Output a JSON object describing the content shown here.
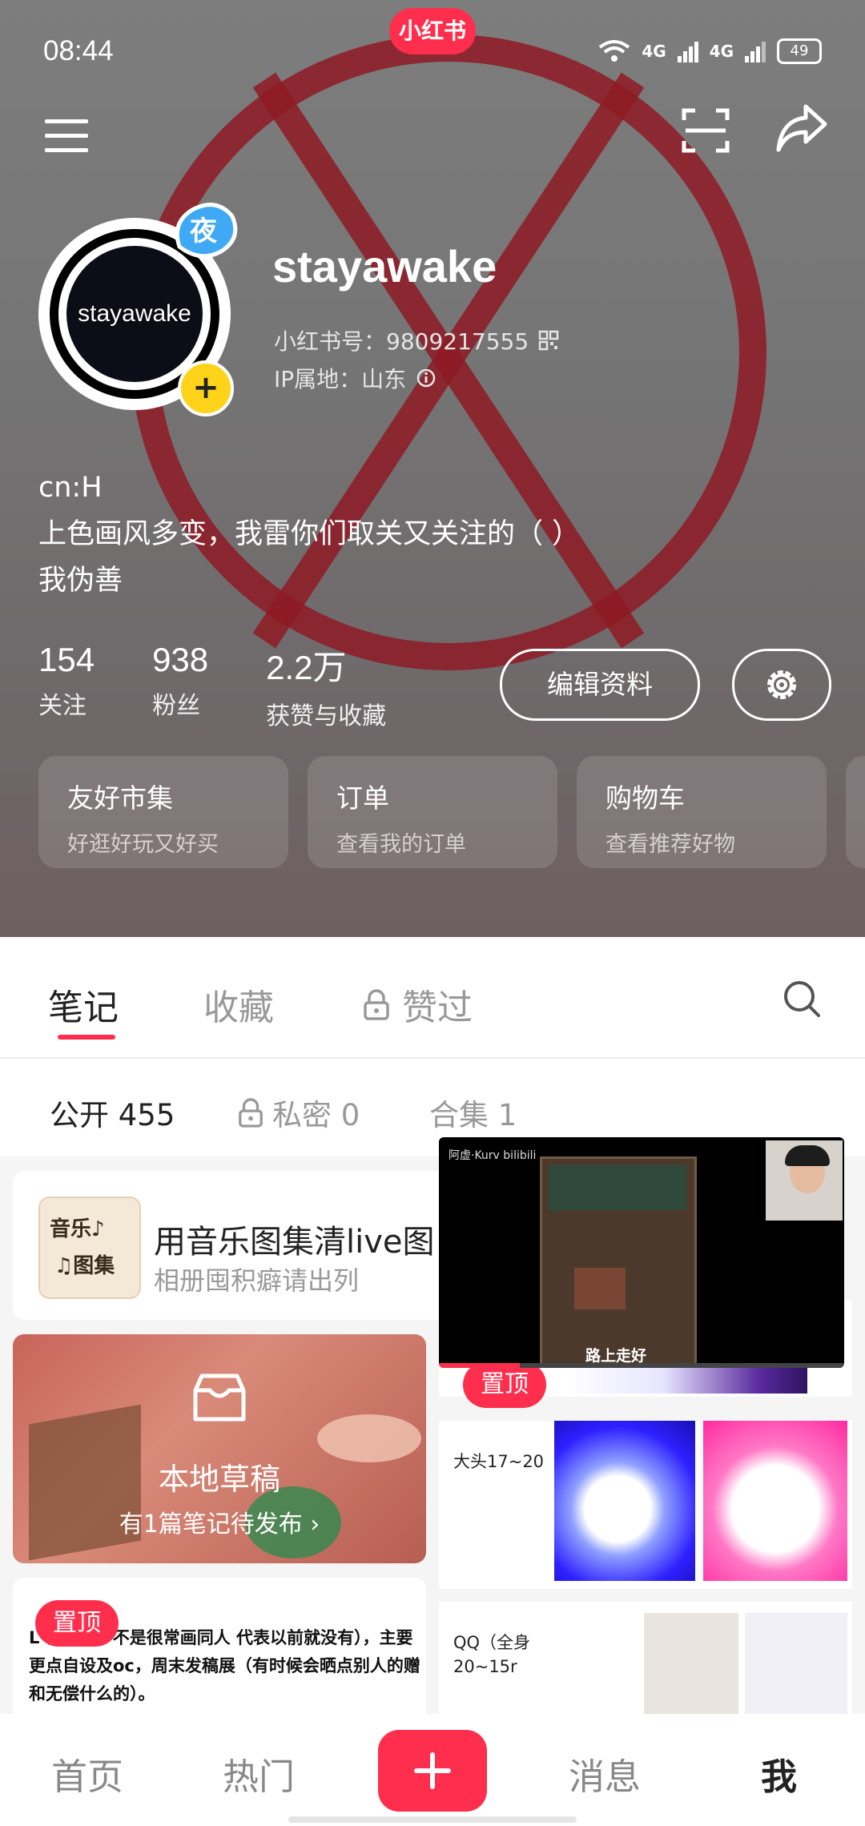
{
  "status_bar": {
    "time": "08:44",
    "app_badge": "小红书",
    "network1": "4G",
    "network2": "4G",
    "battery": "49"
  },
  "profile": {
    "avatar_text": "stayawake",
    "nickname": "stayawake",
    "redbook_id_label": "小红书号：9809217555",
    "ip_label": "IP属地：山东",
    "bio": [
      "cn:H",
      " 上色画风多变，我雷你们取关又关注的（ ）",
      "我伪善"
    ]
  },
  "stats": [
    {
      "value": "154",
      "label": "关注"
    },
    {
      "value": "938",
      "label": "粉丝"
    },
    {
      "value": "2.2万",
      "label": "获赞与收藏"
    }
  ],
  "edit_button": "编辑资料",
  "cards": [
    {
      "title": "友好市集",
      "subtitle": "好逛好玩又好买"
    },
    {
      "title": "订单",
      "subtitle": "查看我的订单"
    },
    {
      "title": "购物车",
      "subtitle": "查看推荐好物"
    }
  ],
  "tabs": [
    {
      "label": "笔记"
    },
    {
      "label": "收藏"
    },
    {
      "label": "赞过"
    }
  ],
  "subtabs": [
    {
      "label": "公开 455"
    },
    {
      "label": "私密 0"
    },
    {
      "label": "合集 1"
    }
  ],
  "feed": {
    "music": {
      "thumb1": "音乐♪",
      "thumb2": "♫图集",
      "title": "用音乐图集清live图",
      "subtitle": "相册囤积癖请出列"
    },
    "draft": {
      "title": "本地草稿",
      "subtitle": "有1篇笔记待发布 ›"
    },
    "pinned_label": "置顶",
    "text_note": "L 创作者，不是很常画同人 代表以前就没有），主要更点自设及oc，周末发稿展（有时候会晒点别人的赠和无偿什么的）。",
    "right_notes": [
      {
        "label": "大头17~20"
      },
      {
        "label": "QQ（全身\n20~15r"
      }
    ]
  },
  "video": {
    "meta": "阿虚·Kurv  bilibili",
    "caption": "路上走好",
    "progress": 0.2
  },
  "bottom_nav": [
    {
      "label": "首页"
    },
    {
      "label": "热门"
    },
    {
      "label": "消息"
    },
    {
      "label": "我"
    }
  ],
  "colors": {
    "accent": "#ff2e4d",
    "avatar_badge": "#ffd31a"
  }
}
